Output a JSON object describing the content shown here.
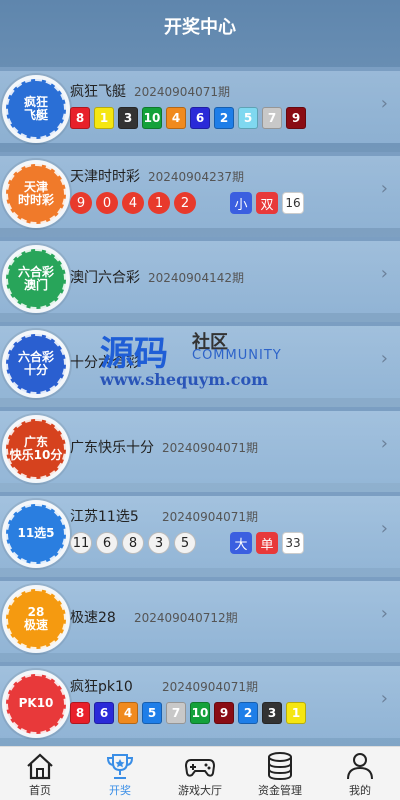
{
  "header": {
    "title": "开奖中心"
  },
  "lotteries": [
    {
      "name": "疯狂飞艇",
      "issue": "20240904071期",
      "logo": {
        "lines": [
          "疯狂",
          "飞艇"
        ],
        "color": "#2a6fd6"
      },
      "balls": [
        "8",
        "1",
        "3",
        "10",
        "4",
        "6",
        "2",
        "5",
        "7",
        "9"
      ],
      "ball_style": "square",
      "ball_colors": [
        "#e8202a",
        "#f5e611",
        "#333333",
        "#14a13a",
        "#f08a1e",
        "#2a2ad8",
        "#1e7ee8",
        "#7fd8f0",
        "#c8c8c8",
        "#8a0c14"
      ]
    },
    {
      "name": "天津时时彩",
      "issue": "20240904237期",
      "logo": {
        "lines": [
          "天津",
          "时时彩"
        ],
        "color": "#f07a2a"
      },
      "balls": [
        "9",
        "0",
        "4",
        "1",
        "2"
      ],
      "ball_style": "red",
      "tags": [
        {
          "text": "小",
          "color": "#3b5fe0"
        },
        {
          "text": "双",
          "color": "#e8393a"
        }
      ],
      "extra": "16"
    },
    {
      "name": "澳门六合彩",
      "issue": "20240904142期",
      "logo": {
        "lines": [
          "六合彩",
          "澳门"
        ],
        "color": "#28a55a"
      }
    },
    {
      "name": "十分六合彩",
      "issue": "",
      "logo": {
        "lines": [
          "六合彩",
          "十分"
        ],
        "color": "#2a5fd0"
      }
    },
    {
      "name": "广东快乐十分",
      "issue": "20240904071期",
      "logo": {
        "lines": [
          "广东",
          "快乐10分"
        ],
        "color": "#d6421e"
      }
    },
    {
      "name": "江苏11选5",
      "issue": "20240904071期",
      "logo": {
        "lines": [
          "11选5"
        ],
        "color": "#2a7ee0"
      },
      "balls": [
        "11",
        "6",
        "8",
        "3",
        "5"
      ],
      "ball_style": "grey",
      "tags": [
        {
          "text": "大",
          "color": "#3b5fe0"
        },
        {
          "text": "单",
          "color": "#e8393a"
        }
      ],
      "extra": "33"
    },
    {
      "name": "极速28",
      "issue": "20240904071 2期",
      "logo": {
        "lines": [
          "28",
          "极速"
        ],
        "color": "#f59a10"
      }
    },
    {
      "name": "疯狂pk10",
      "issue": "20240904071期",
      "logo": {
        "lines": [
          "PK10"
        ],
        "color": "#e8393a"
      },
      "balls": [
        "8",
        "6",
        "4",
        "5",
        "7",
        "10",
        "9",
        "2",
        "3",
        "1"
      ],
      "ball_style": "square",
      "ball_colors": [
        "#e8202a",
        "#2a2ad8",
        "#f08a1e",
        "#1e7ee8",
        "#c8c8c8",
        "#14a13a",
        "#8a0c14",
        "#1e7ee8",
        "#333333",
        "#f5e611"
      ]
    }
  ],
  "watermark": {
    "big": "源码",
    "she": "社区",
    "community": "COMMUNITY",
    "url": "www.shequym.com"
  },
  "tabbar": {
    "items": [
      {
        "label": "首页",
        "icon": "home-icon"
      },
      {
        "label": "开奖",
        "icon": "trophy-icon",
        "active": true
      },
      {
        "label": "游戏大厅",
        "icon": "gamepad-icon"
      },
      {
        "label": "资金管理",
        "icon": "coins-icon"
      },
      {
        "label": "我的",
        "icon": "user-icon"
      }
    ]
  }
}
